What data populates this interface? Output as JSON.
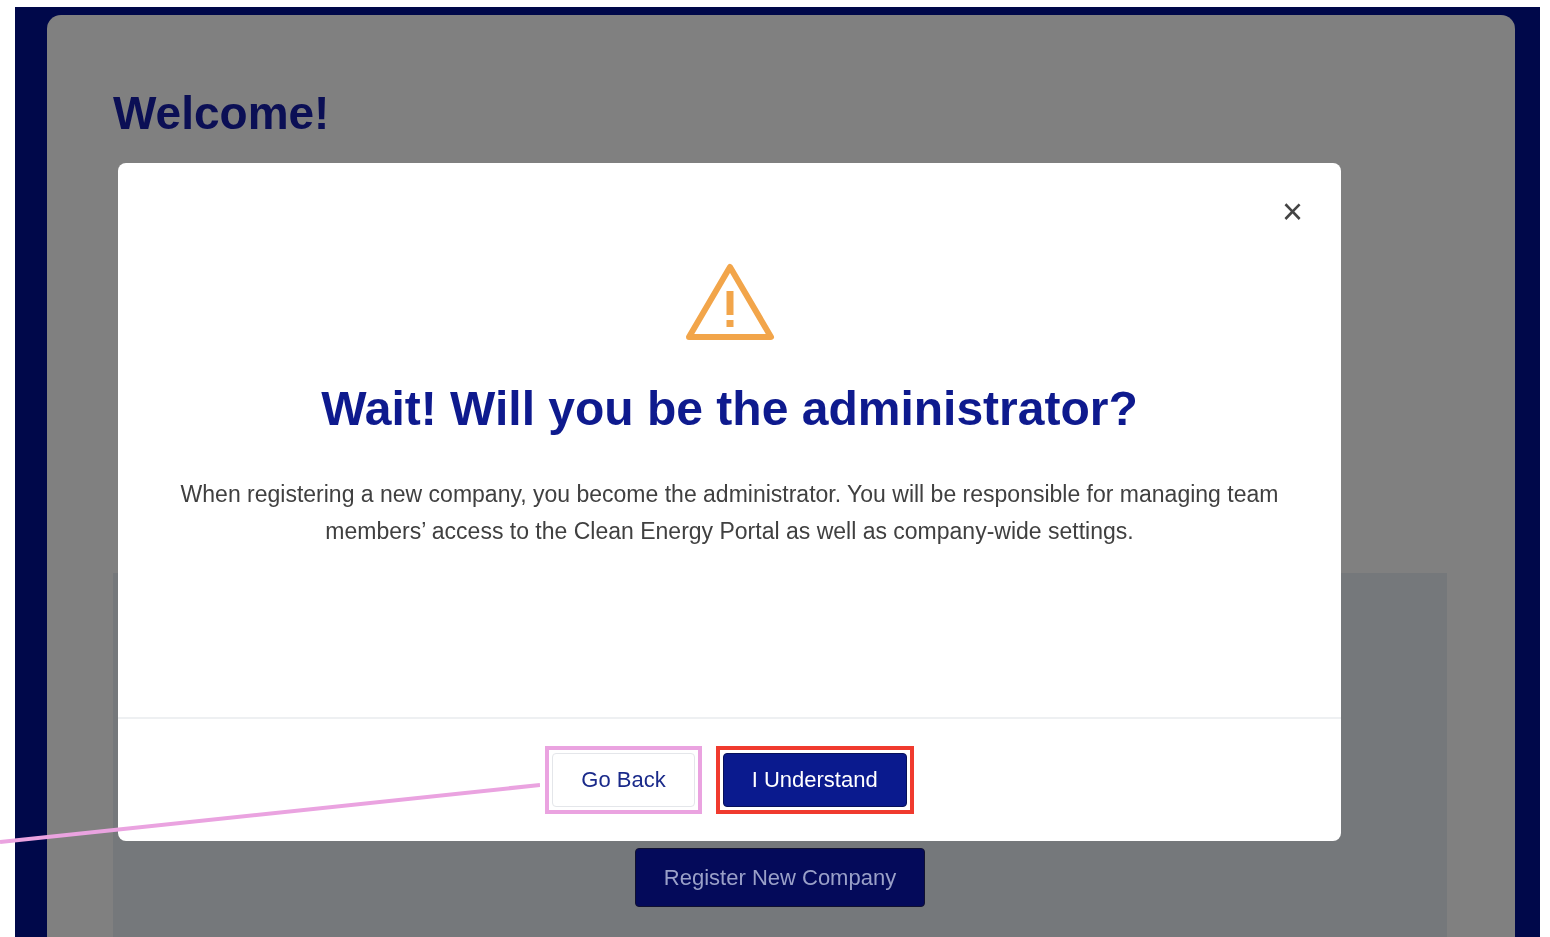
{
  "page": {
    "heading": "Welcome!",
    "register_button": "Register New Company"
  },
  "modal": {
    "close": "×",
    "title": "Wait! Will you be the administrator?",
    "message": "When registering a new company, you become the administrator. You will be responsible for managing team members’ access to the Clean Energy Portal as well as company-wide settings.",
    "buttons": [
      {
        "label": "Go Back",
        "kind": "secondary",
        "color": "#eaa3e0"
      },
      {
        "label": "I Understand",
        "kind": "primary",
        "color": "#f03a2e"
      }
    ]
  }
}
